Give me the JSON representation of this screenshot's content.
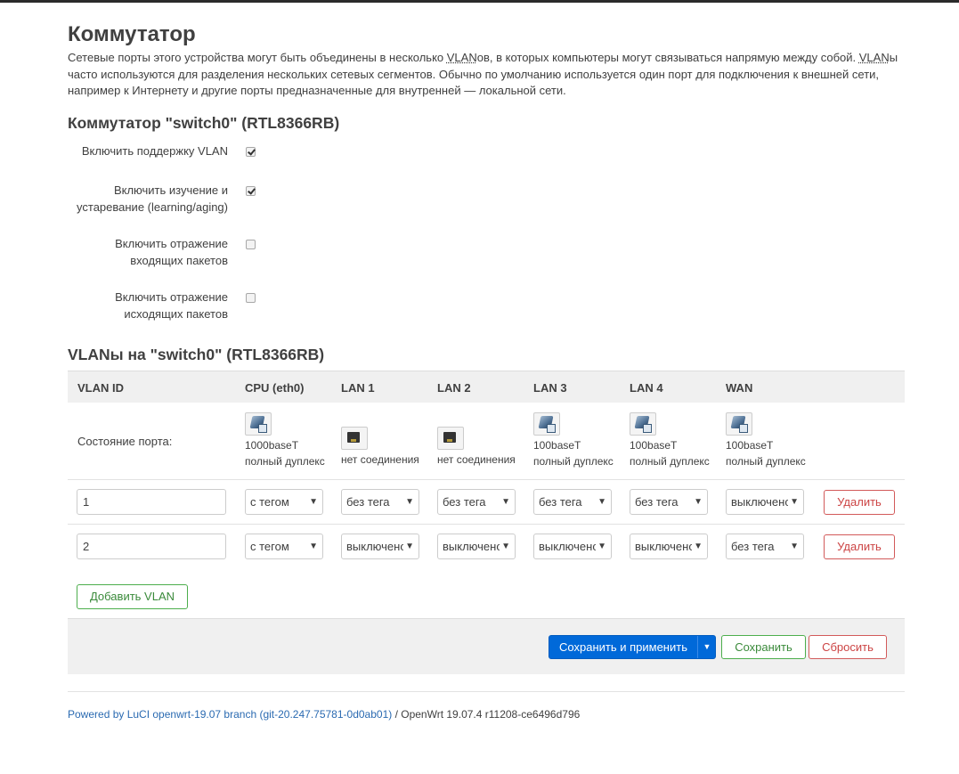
{
  "page": {
    "title": "Коммутатор",
    "description_parts": [
      "Сетевые порты этого устройства могут быть объединены в несколько ",
      "VLAN",
      "ов, в которых компьютеры могут связываться напрямую между собой. ",
      "VLAN",
      "ы часто используются для разделения нескольких сетевых сегментов. Обычно по умолчанию используется один порт для подключения к внешней сети, например к Интернету и другие порты предназначенные для внутренней — локальной сети."
    ]
  },
  "switch_section": {
    "title": "Коммутатор \"switch0\" (RTL8366RB)",
    "options": [
      {
        "label": "Включить поддержку VLAN",
        "checked": true
      },
      {
        "label_line1": "Включить изучение и",
        "label_line2": "устаревание (learning/aging)",
        "checked": true
      },
      {
        "label_line1": "Включить отражение",
        "label_line2": "входящих пакетов",
        "checked": false
      },
      {
        "label_line1": "Включить отражение",
        "label_line2": "исходящих пакетов",
        "checked": false
      }
    ]
  },
  "vlans_section": {
    "title": "VLANы на \"switch0\" (RTL8366RB)",
    "columns": [
      "VLAN ID",
      "CPU (eth0)",
      "LAN 1",
      "LAN 2",
      "LAN 3",
      "LAN 4",
      "WAN"
    ],
    "port_state_label": "Состояние порта:",
    "ports": [
      {
        "state": "up",
        "line1": "1000baseT",
        "line2": "полный дуплекс"
      },
      {
        "state": "down",
        "line1": "нет соединения",
        "line2": ""
      },
      {
        "state": "down",
        "line1": "нет соединения",
        "line2": ""
      },
      {
        "state": "up",
        "line1": "100baseT",
        "line2": "полный дуплекс"
      },
      {
        "state": "up",
        "line1": "100baseT",
        "line2": "полный дуплекс"
      },
      {
        "state": "up",
        "line1": "100baseT",
        "line2": "полный дуплекс"
      }
    ],
    "rows": [
      {
        "vlan_id": "1",
        "ports": [
          "с тегом",
          "без тега",
          "без тега",
          "без тега",
          "без тега",
          "выключено"
        ]
      },
      {
        "vlan_id": "2",
        "ports": [
          "с тегом",
          "выключено",
          "выключено",
          "выключено",
          "выключено",
          "без тега"
        ]
      }
    ],
    "delete_label": "Удалить",
    "add_label": "Добавить VLAN"
  },
  "actions": {
    "apply_label": "Сохранить и применить",
    "save_label": "Сохранить",
    "reset_label": "Сбросить"
  },
  "footer": {
    "link_text": "Powered by LuCI openwrt-19.07 branch (git-20.247.75781-0d0ab01)",
    "version_text": " / OpenWrt 19.07.4 r11208-ce6496d796"
  },
  "colors": {
    "primary": "#0069d9",
    "positive": "#4cae4c",
    "negative": "#d25a5a",
    "link": "#2a6ab1"
  }
}
